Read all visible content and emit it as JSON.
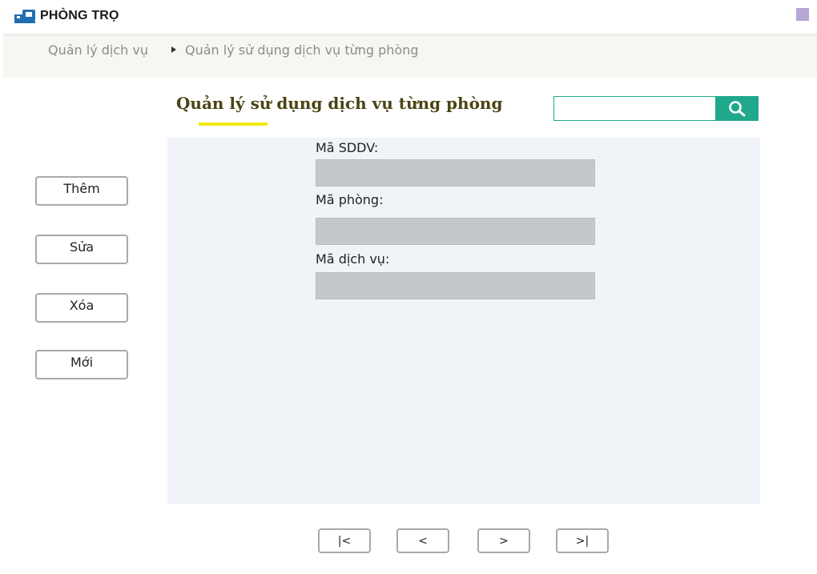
{
  "app": {
    "logo_text": "PHÒNG TRỌ"
  },
  "breadcrumb": {
    "items": [
      "Quản lý dịch vụ",
      "Quản lý sử dụng dịch vụ từng phòng"
    ]
  },
  "page": {
    "title": "Quản lý sử dụng dịch vụ từng phòng"
  },
  "search": {
    "value": "",
    "placeholder": "",
    "icon": "search-icon"
  },
  "actions": {
    "add": "Thêm",
    "edit": "Sửa",
    "delete": "Xóa",
    "new": "Mới"
  },
  "form": {
    "fields": [
      {
        "label": "Mã SDDV:",
        "value": ""
      },
      {
        "label": "Mã phòng:",
        "value": ""
      },
      {
        "label": "Mã dịch vụ:",
        "value": ""
      }
    ]
  },
  "pager": {
    "first": "|<",
    "prev": "<",
    "next": ">",
    "last": ">|"
  },
  "colors": {
    "accent": "#1fa88c",
    "title": "#4a4413",
    "underline": "#f3ea12",
    "brand": "#1f6fb2"
  }
}
